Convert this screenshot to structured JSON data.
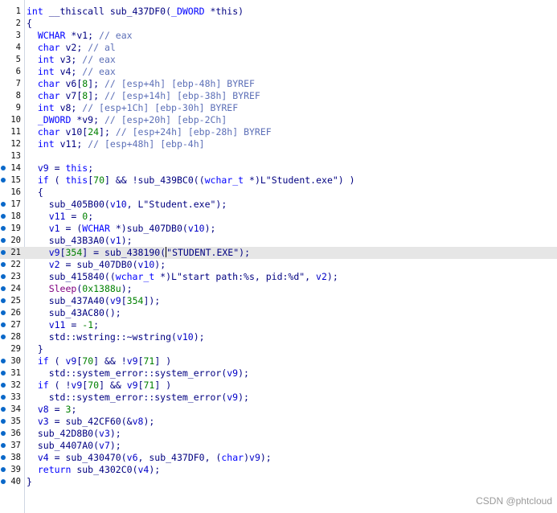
{
  "editor": {
    "lines": [
      {
        "n": "1",
        "dot": false,
        "hl": false,
        "tokens": [
          [
            "ty",
            "int"
          ],
          [
            "pl",
            " __thiscall sub_437DF0("
          ],
          [
            "ty",
            "_DWORD"
          ],
          [
            "pl",
            " *this)"
          ]
        ]
      },
      {
        "n": "2",
        "dot": false,
        "hl": false,
        "tokens": [
          [
            "pl",
            "{"
          ]
        ]
      },
      {
        "n": "3",
        "dot": false,
        "hl": false,
        "tokens": [
          [
            "pl",
            "  "
          ],
          [
            "ty",
            "WCHAR"
          ],
          [
            "pl",
            " *v1; "
          ],
          [
            "cm",
            "// eax"
          ]
        ]
      },
      {
        "n": "4",
        "dot": false,
        "hl": false,
        "tokens": [
          [
            "pl",
            "  "
          ],
          [
            "ty",
            "char"
          ],
          [
            "pl",
            " v2; "
          ],
          [
            "cm",
            "// al"
          ]
        ]
      },
      {
        "n": "5",
        "dot": false,
        "hl": false,
        "tokens": [
          [
            "pl",
            "  "
          ],
          [
            "ty",
            "int"
          ],
          [
            "pl",
            " v3; "
          ],
          [
            "cm",
            "// eax"
          ]
        ]
      },
      {
        "n": "6",
        "dot": false,
        "hl": false,
        "tokens": [
          [
            "pl",
            "  "
          ],
          [
            "ty",
            "int"
          ],
          [
            "pl",
            " v4; "
          ],
          [
            "cm",
            "// eax"
          ]
        ]
      },
      {
        "n": "7",
        "dot": false,
        "hl": false,
        "tokens": [
          [
            "pl",
            "  "
          ],
          [
            "ty",
            "char"
          ],
          [
            "pl",
            " v6["
          ],
          [
            "n",
            "8"
          ],
          [
            "pl",
            "]; "
          ],
          [
            "cm",
            "// [esp+4h] [ebp-48h] BYREF"
          ]
        ]
      },
      {
        "n": "8",
        "dot": false,
        "hl": false,
        "tokens": [
          [
            "pl",
            "  "
          ],
          [
            "ty",
            "char"
          ],
          [
            "pl",
            " v7["
          ],
          [
            "n",
            "8"
          ],
          [
            "pl",
            "]; "
          ],
          [
            "cm",
            "// [esp+14h] [ebp-38h] BYREF"
          ]
        ]
      },
      {
        "n": "9",
        "dot": false,
        "hl": false,
        "tokens": [
          [
            "pl",
            "  "
          ],
          [
            "ty",
            "int"
          ],
          [
            "pl",
            " v8; "
          ],
          [
            "cm",
            "// [esp+1Ch] [ebp-30h] BYREF"
          ]
        ]
      },
      {
        "n": "10",
        "dot": false,
        "hl": false,
        "tokens": [
          [
            "pl",
            "  "
          ],
          [
            "ty",
            "_DWORD"
          ],
          [
            "pl",
            " *v9; "
          ],
          [
            "cm",
            "// [esp+20h] [ebp-2Ch]"
          ]
        ]
      },
      {
        "n": "11",
        "dot": false,
        "hl": false,
        "tokens": [
          [
            "pl",
            "  "
          ],
          [
            "ty",
            "char"
          ],
          [
            "pl",
            " v10["
          ],
          [
            "n",
            "24"
          ],
          [
            "pl",
            "]; "
          ],
          [
            "cm",
            "// [esp+24h] [ebp-28h] BYREF"
          ]
        ]
      },
      {
        "n": "12",
        "dot": false,
        "hl": false,
        "tokens": [
          [
            "pl",
            "  "
          ],
          [
            "ty",
            "int"
          ],
          [
            "pl",
            " v11; "
          ],
          [
            "cm",
            "// [esp+48h] [ebp-4h]"
          ]
        ]
      },
      {
        "n": "13",
        "dot": false,
        "hl": false,
        "tokens": []
      },
      {
        "n": "14",
        "dot": true,
        "hl": false,
        "tokens": [
          [
            "pl",
            "  "
          ],
          [
            "v",
            "v9"
          ],
          [
            "pl",
            " = "
          ],
          [
            "k",
            "this"
          ],
          [
            "pl",
            ";"
          ]
        ]
      },
      {
        "n": "15",
        "dot": true,
        "hl": false,
        "tokens": [
          [
            "pl",
            "  "
          ],
          [
            "k",
            "if"
          ],
          [
            "pl",
            " ( "
          ],
          [
            "k",
            "this"
          ],
          [
            "pl",
            "["
          ],
          [
            "n",
            "70"
          ],
          [
            "pl",
            "] && !sub_439BC0(("
          ],
          [
            "ty",
            "wchar_t"
          ],
          [
            "pl",
            " *)L\"Student.exe\") )"
          ]
        ]
      },
      {
        "n": "16",
        "dot": false,
        "hl": false,
        "tokens": [
          [
            "pl",
            "  {"
          ]
        ]
      },
      {
        "n": "17",
        "dot": true,
        "hl": false,
        "tokens": [
          [
            "pl",
            "    sub_405B00("
          ],
          [
            "v",
            "v10"
          ],
          [
            "pl",
            ", L\"Student.exe\");"
          ]
        ]
      },
      {
        "n": "18",
        "dot": true,
        "hl": false,
        "tokens": [
          [
            "pl",
            "    "
          ],
          [
            "v",
            "v11"
          ],
          [
            "pl",
            " = "
          ],
          [
            "n",
            "0"
          ],
          [
            "pl",
            ";"
          ]
        ]
      },
      {
        "n": "19",
        "dot": true,
        "hl": false,
        "tokens": [
          [
            "pl",
            "    "
          ],
          [
            "v",
            "v1"
          ],
          [
            "pl",
            " = ("
          ],
          [
            "ty",
            "WCHAR"
          ],
          [
            "pl",
            " *)sub_407DB0("
          ],
          [
            "v",
            "v10"
          ],
          [
            "pl",
            ");"
          ]
        ]
      },
      {
        "n": "20",
        "dot": true,
        "hl": false,
        "tokens": [
          [
            "pl",
            "    sub_43B3A0("
          ],
          [
            "v",
            "v1"
          ],
          [
            "pl",
            ");"
          ]
        ]
      },
      {
        "n": "21",
        "dot": true,
        "hl": true,
        "tokens": [
          [
            "pl",
            "    "
          ],
          [
            "v",
            "v9"
          ],
          [
            "pl",
            "["
          ],
          [
            "n",
            "354"
          ],
          [
            "pl",
            "] = sub_438190("
          ],
          [
            "caret",
            ""
          ],
          [
            "pl",
            "\"STUDENT.EXE\");"
          ]
        ]
      },
      {
        "n": "22",
        "dot": true,
        "hl": false,
        "tokens": [
          [
            "pl",
            "    "
          ],
          [
            "v",
            "v2"
          ],
          [
            "pl",
            " = sub_407DB0("
          ],
          [
            "v",
            "v10"
          ],
          [
            "pl",
            ");"
          ]
        ]
      },
      {
        "n": "23",
        "dot": true,
        "hl": false,
        "tokens": [
          [
            "pl",
            "    sub_415840(("
          ],
          [
            "ty",
            "wchar_t"
          ],
          [
            "pl",
            " *)L\"start path:%s, pid:%d\", "
          ],
          [
            "v",
            "v2"
          ],
          [
            "pl",
            ");"
          ]
        ]
      },
      {
        "n": "24",
        "dot": true,
        "hl": false,
        "tokens": [
          [
            "pl",
            "    "
          ],
          [
            "ex",
            "Sleep"
          ],
          [
            "pl",
            "("
          ],
          [
            "n",
            "0x1388u"
          ],
          [
            "pl",
            ");"
          ]
        ]
      },
      {
        "n": "25",
        "dot": true,
        "hl": false,
        "tokens": [
          [
            "pl",
            "    sub_437A40("
          ],
          [
            "v",
            "v9"
          ],
          [
            "pl",
            "["
          ],
          [
            "n",
            "354"
          ],
          [
            "pl",
            "]);"
          ]
        ]
      },
      {
        "n": "26",
        "dot": true,
        "hl": false,
        "tokens": [
          [
            "pl",
            "    sub_43AC80();"
          ]
        ]
      },
      {
        "n": "27",
        "dot": true,
        "hl": false,
        "tokens": [
          [
            "pl",
            "    "
          ],
          [
            "v",
            "v11"
          ],
          [
            "pl",
            " = "
          ],
          [
            "n",
            "-1"
          ],
          [
            "pl",
            ";"
          ]
        ]
      },
      {
        "n": "28",
        "dot": true,
        "hl": false,
        "tokens": [
          [
            "pl",
            "    std::wstring::~wstring("
          ],
          [
            "v",
            "v10"
          ],
          [
            "pl",
            ");"
          ]
        ]
      },
      {
        "n": "29",
        "dot": false,
        "hl": false,
        "tokens": [
          [
            "pl",
            "  }"
          ]
        ]
      },
      {
        "n": "30",
        "dot": true,
        "hl": false,
        "tokens": [
          [
            "pl",
            "  "
          ],
          [
            "k",
            "if"
          ],
          [
            "pl",
            " ( "
          ],
          [
            "v",
            "v9"
          ],
          [
            "pl",
            "["
          ],
          [
            "n",
            "70"
          ],
          [
            "pl",
            "] && !"
          ],
          [
            "v",
            "v9"
          ],
          [
            "pl",
            "["
          ],
          [
            "n",
            "71"
          ],
          [
            "pl",
            "] )"
          ]
        ]
      },
      {
        "n": "31",
        "dot": true,
        "hl": false,
        "tokens": [
          [
            "pl",
            "    std::system_error::system_error("
          ],
          [
            "v",
            "v9"
          ],
          [
            "pl",
            ");"
          ]
        ]
      },
      {
        "n": "32",
        "dot": true,
        "hl": false,
        "tokens": [
          [
            "pl",
            "  "
          ],
          [
            "k",
            "if"
          ],
          [
            "pl",
            " ( !"
          ],
          [
            "v",
            "v9"
          ],
          [
            "pl",
            "["
          ],
          [
            "n",
            "70"
          ],
          [
            "pl",
            "] && "
          ],
          [
            "v",
            "v9"
          ],
          [
            "pl",
            "["
          ],
          [
            "n",
            "71"
          ],
          [
            "pl",
            "] )"
          ]
        ]
      },
      {
        "n": "33",
        "dot": true,
        "hl": false,
        "tokens": [
          [
            "pl",
            "    std::system_error::system_error("
          ],
          [
            "v",
            "v9"
          ],
          [
            "pl",
            ");"
          ]
        ]
      },
      {
        "n": "34",
        "dot": true,
        "hl": false,
        "tokens": [
          [
            "pl",
            "  "
          ],
          [
            "v",
            "v8"
          ],
          [
            "pl",
            " = "
          ],
          [
            "n",
            "3"
          ],
          [
            "pl",
            ";"
          ]
        ]
      },
      {
        "n": "35",
        "dot": true,
        "hl": false,
        "tokens": [
          [
            "pl",
            "  "
          ],
          [
            "v",
            "v3"
          ],
          [
            "pl",
            " = sub_42CF60(&"
          ],
          [
            "v",
            "v8"
          ],
          [
            "pl",
            ");"
          ]
        ]
      },
      {
        "n": "36",
        "dot": true,
        "hl": false,
        "tokens": [
          [
            "pl",
            "  sub_42D8B0("
          ],
          [
            "v",
            "v3"
          ],
          [
            "pl",
            ");"
          ]
        ]
      },
      {
        "n": "37",
        "dot": true,
        "hl": false,
        "tokens": [
          [
            "pl",
            "  sub_4407A0("
          ],
          [
            "v",
            "v7"
          ],
          [
            "pl",
            ");"
          ]
        ]
      },
      {
        "n": "38",
        "dot": true,
        "hl": false,
        "tokens": [
          [
            "pl",
            "  "
          ],
          [
            "v",
            "v4"
          ],
          [
            "pl",
            " = sub_430470("
          ],
          [
            "v",
            "v6"
          ],
          [
            "pl",
            ", sub_437DF0, ("
          ],
          [
            "ty",
            "char"
          ],
          [
            "pl",
            ")"
          ],
          [
            "v",
            "v9"
          ],
          [
            "pl",
            ");"
          ]
        ]
      },
      {
        "n": "39",
        "dot": true,
        "hl": false,
        "tokens": [
          [
            "pl",
            "  "
          ],
          [
            "k",
            "return"
          ],
          [
            "pl",
            " sub_4302C0("
          ],
          [
            "v",
            "v4"
          ],
          [
            "pl",
            ");"
          ]
        ]
      },
      {
        "n": "40",
        "dot": true,
        "hl": false,
        "tokens": [
          [
            "pl",
            "}"
          ]
        ]
      }
    ]
  },
  "watermark": "CSDN @phtcloud"
}
